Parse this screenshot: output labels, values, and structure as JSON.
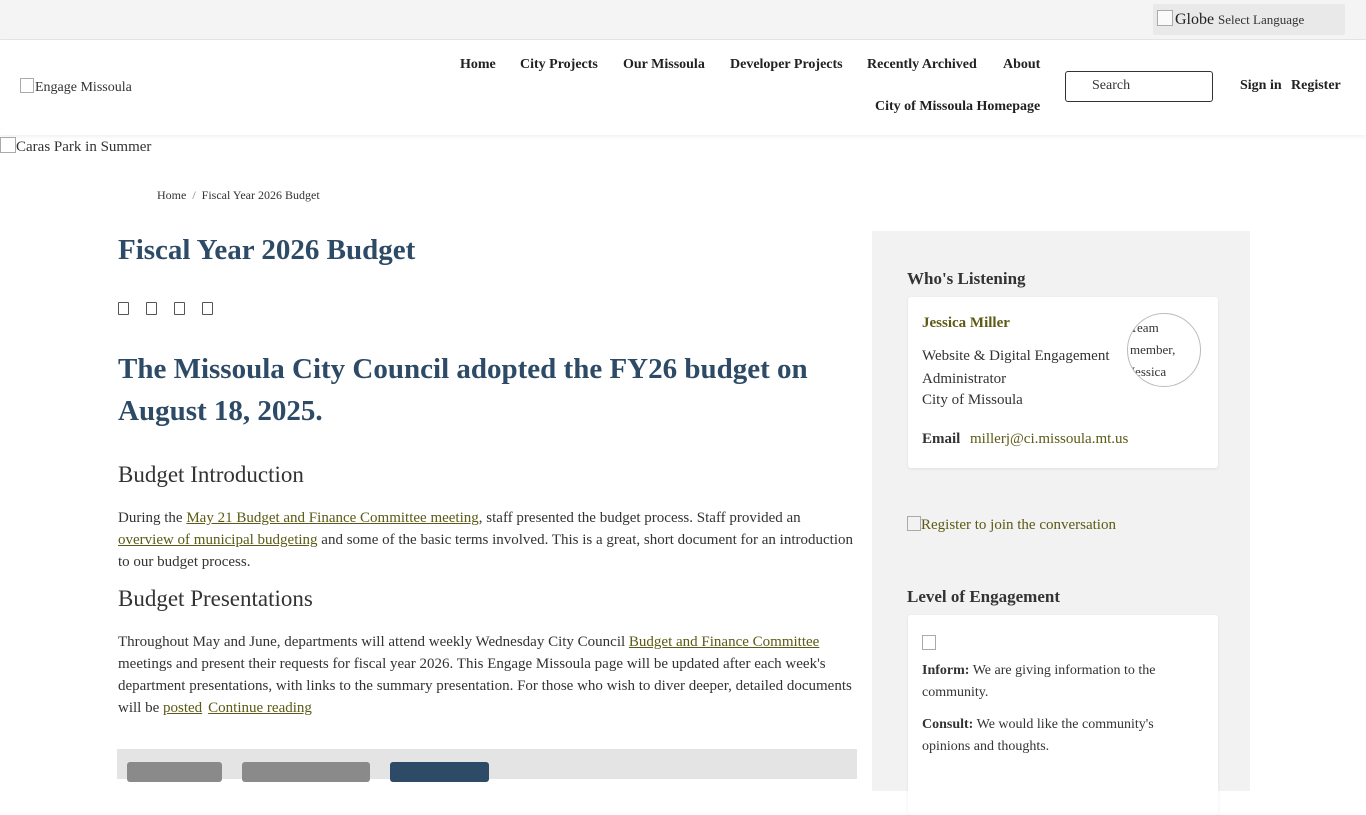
{
  "topbar": {
    "globe_alt": "Globe",
    "language_label": "Select Language"
  },
  "header": {
    "logo_alt": "Engage Missoula",
    "nav": {
      "home": "Home",
      "city_projects": "City Projects",
      "our_missoula": "Our Missoula",
      "developer_projects": "Developer Projects",
      "recently_archived": "Recently Archived",
      "about": "About",
      "city_homepage": "City of Missoula Homepage"
    },
    "search": {
      "icon_glyph": "",
      "placeholder": "Search"
    },
    "sign_in": "Sign in",
    "register": "Register"
  },
  "hero": {
    "alt": "Caras Park in Summer"
  },
  "breadcrumb": {
    "home": "Home",
    "separator": "/",
    "current": "Fiscal Year 2026 Budget"
  },
  "main": {
    "title": "Fiscal Year 2026 Budget",
    "share_icons": [
      "facebook-icon",
      "twitter-icon",
      "linkedin-icon",
      "email-icon"
    ],
    "headline": "The Missoula City Council adopted the FY26 budget on August 18, 2025.",
    "intro": {
      "heading": "Budget Introduction",
      "text_1": "During the ",
      "link_1": "May 21 Budget and Finance Committee meeting",
      "text_2": ", staff presented the budget process. Staff provided an ",
      "link_2": "overview of municipal budgeting",
      "text_3": " and some of the basic terms involved. This is a great, short document for an introduction to our budget process."
    },
    "presentations": {
      "heading": "Budget Presentations",
      "text_1": "Throughout May and June, departments will attend weekly Wednesday City Council ",
      "link_1": "Budget and Finance Committee",
      "text_2": " meetings and present their requests for fiscal year 2026. This Engage Missoula page will be updated after each week's department presentations, with links to the summary presentation. For those who wish to diver deeper, detailed documents will be ",
      "link_2": "posted",
      "continue": "Continue reading"
    },
    "colors": {
      "heading": "#2d4a66",
      "link": "#5c5a14"
    }
  },
  "sidebar": {
    "whos_listening": {
      "heading": "Who's Listening",
      "name": "Jessica Miller",
      "role": "Website & Digital Engagement Administrator",
      "org": "City of Missoula",
      "email_label": "Email",
      "email": "millerj@ci.missoula.mt.us",
      "avatar_alt": "Team member, Jessica"
    },
    "register_alt": "Register to join the conversation",
    "engagement": {
      "heading": "Level of Engagement",
      "items": [
        {
          "label": "Inform:",
          "text": "We are giving information to the community."
        },
        {
          "label": "Consult:",
          "text": "We would like the community's opinions and thoughts."
        }
      ]
    }
  }
}
